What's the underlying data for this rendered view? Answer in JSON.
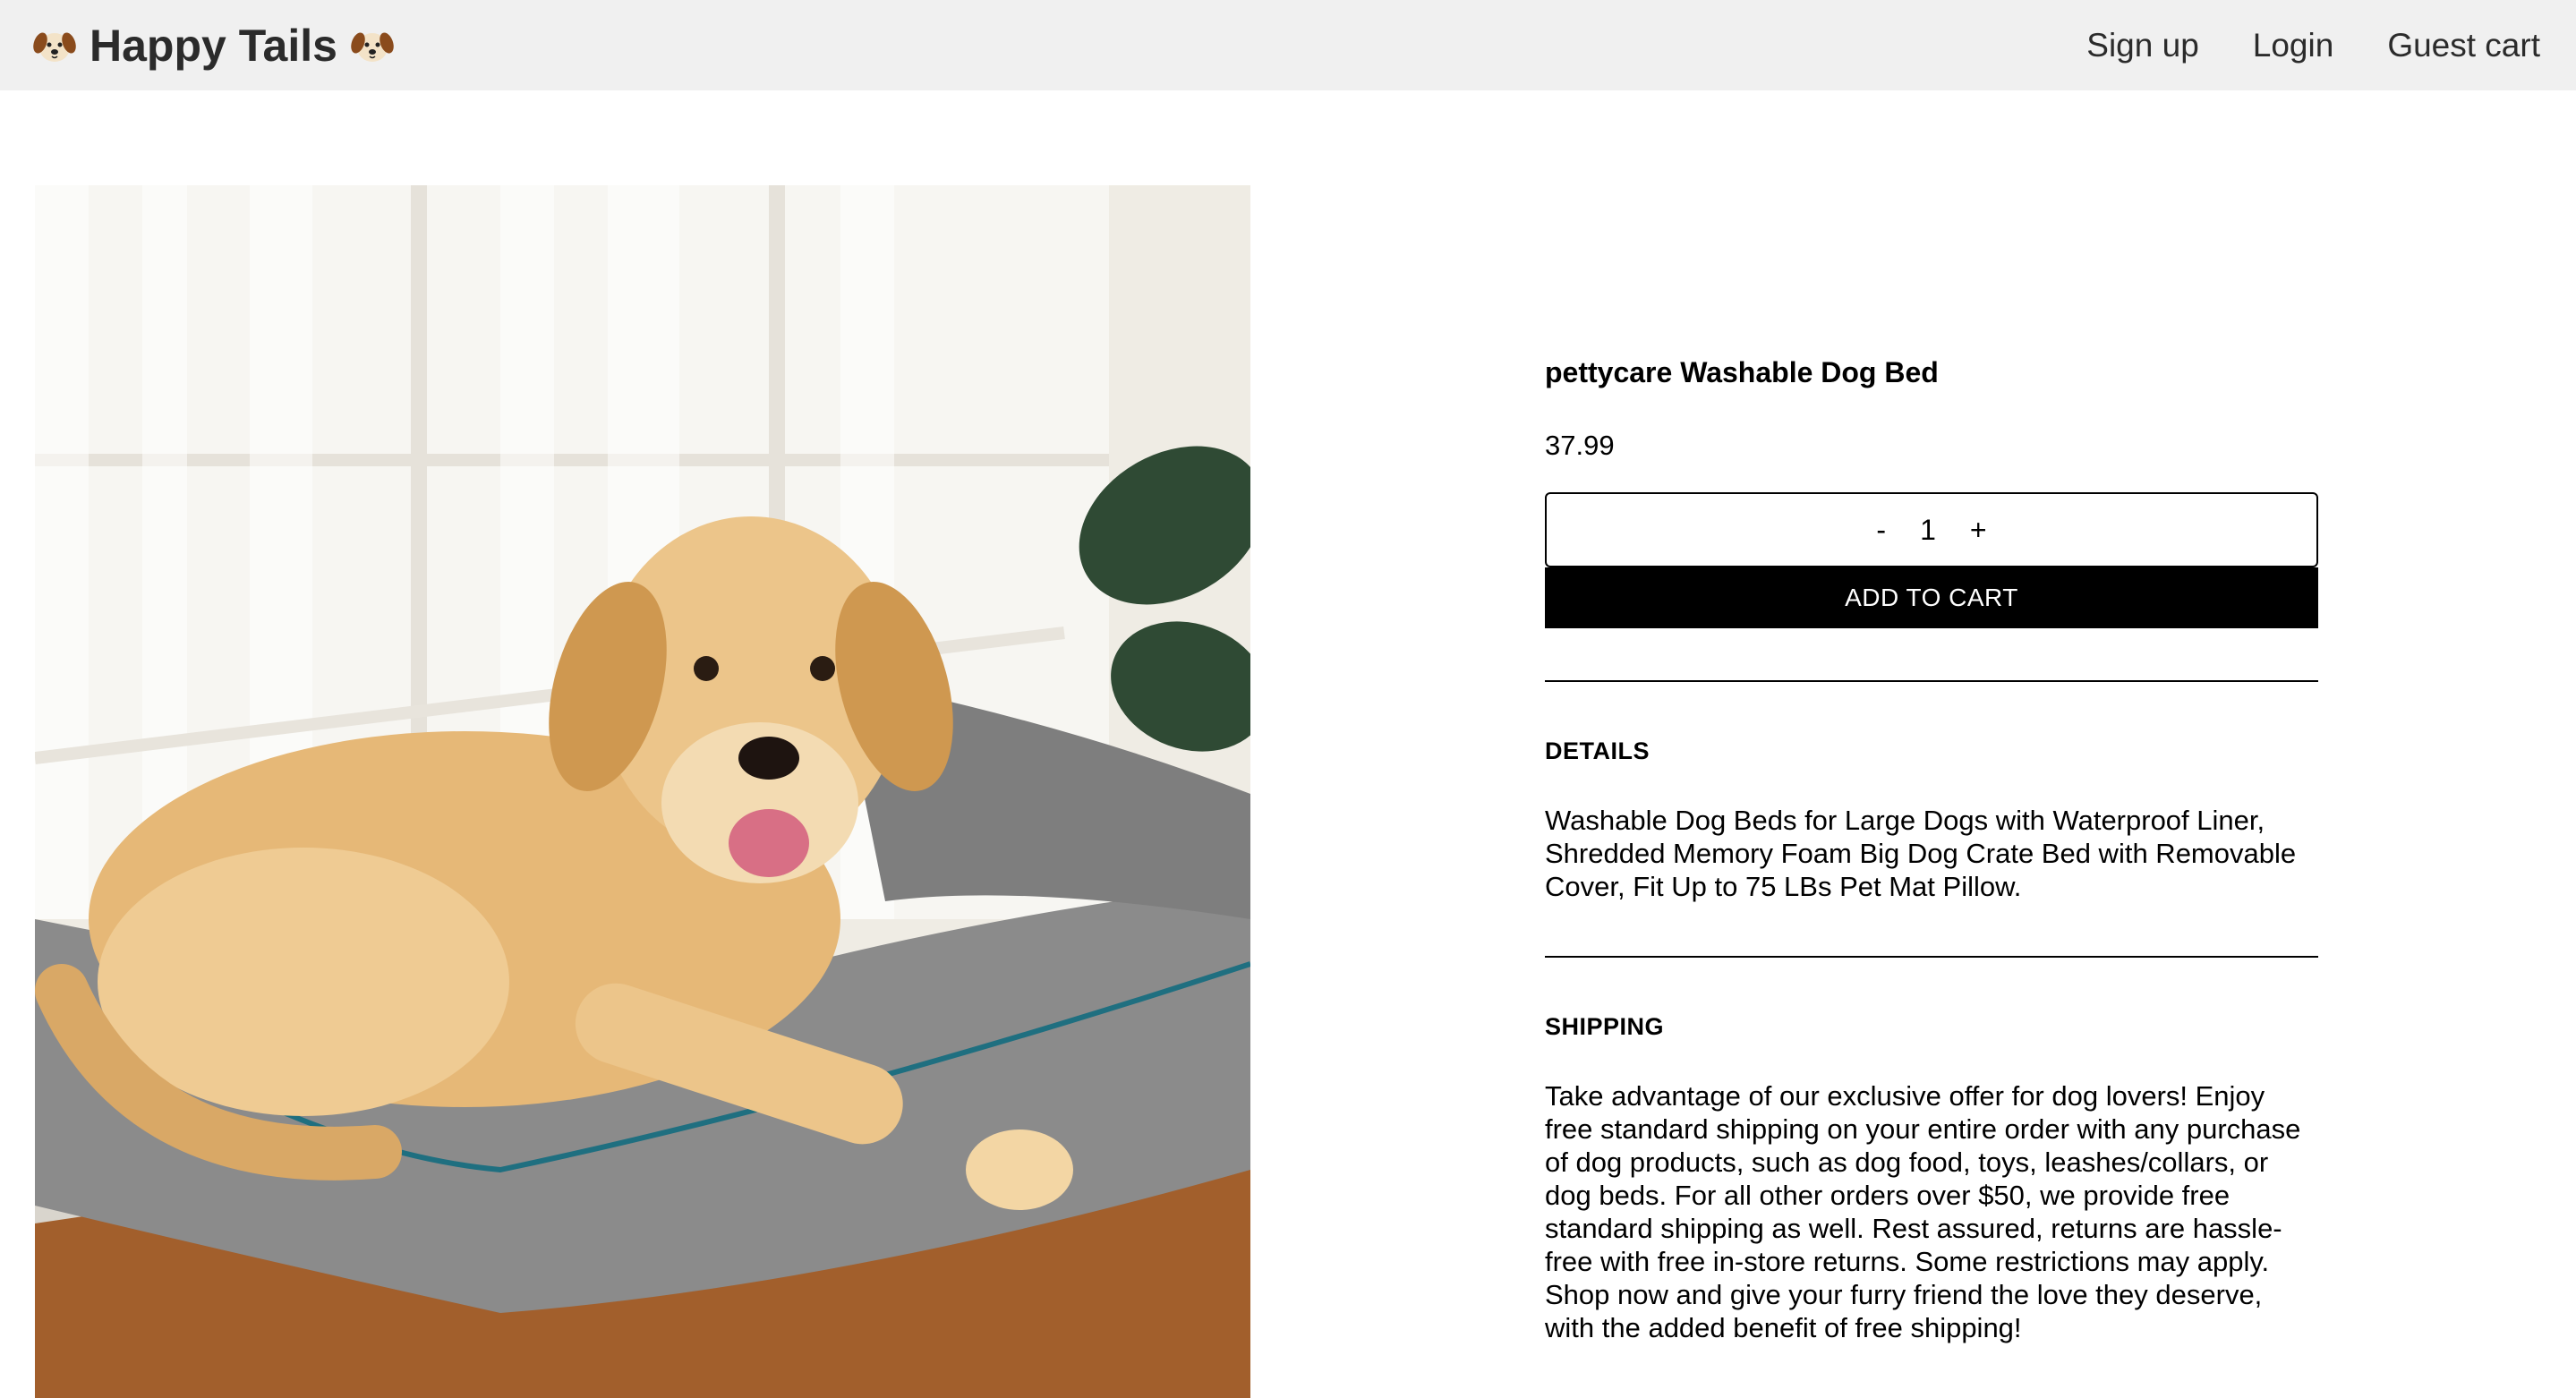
{
  "header": {
    "brand": "Happy Tails",
    "nav": [
      "Sign up",
      "Login",
      "Guest cart"
    ]
  },
  "product": {
    "title": "pettycare Washable Dog Bed",
    "price": "37.99",
    "quantity": {
      "minus": "-",
      "value": "1",
      "plus": "+"
    },
    "add_to_cart": "ADD TO CART",
    "image_alt": "dog-bed-photo"
  },
  "details": {
    "heading": "DETAILS",
    "body": "Washable Dog Beds for Large Dogs with Waterproof Liner, Shredded Memory Foam Big Dog Crate Bed with Removable Cover, Fit Up to 75 LBs Pet Mat Pillow."
  },
  "shipping": {
    "heading": "SHIPPING",
    "body": "Take advantage of our exclusive offer for dog lovers! Enjoy free standard shipping on your entire order with any purchase of dog products, such as dog food, toys, leashes/collars, or dog beds. For all other orders over $50, we provide free standard shipping as well. Rest assured, returns are hassle-free with free in-store returns. Some restrictions may apply. Shop now and give your furry friend the love they deserve, with the added benefit of free shipping!"
  },
  "colors": {
    "header_bg": "#f0f0f0",
    "button_bg": "#000000",
    "button_text": "#ffffff"
  }
}
